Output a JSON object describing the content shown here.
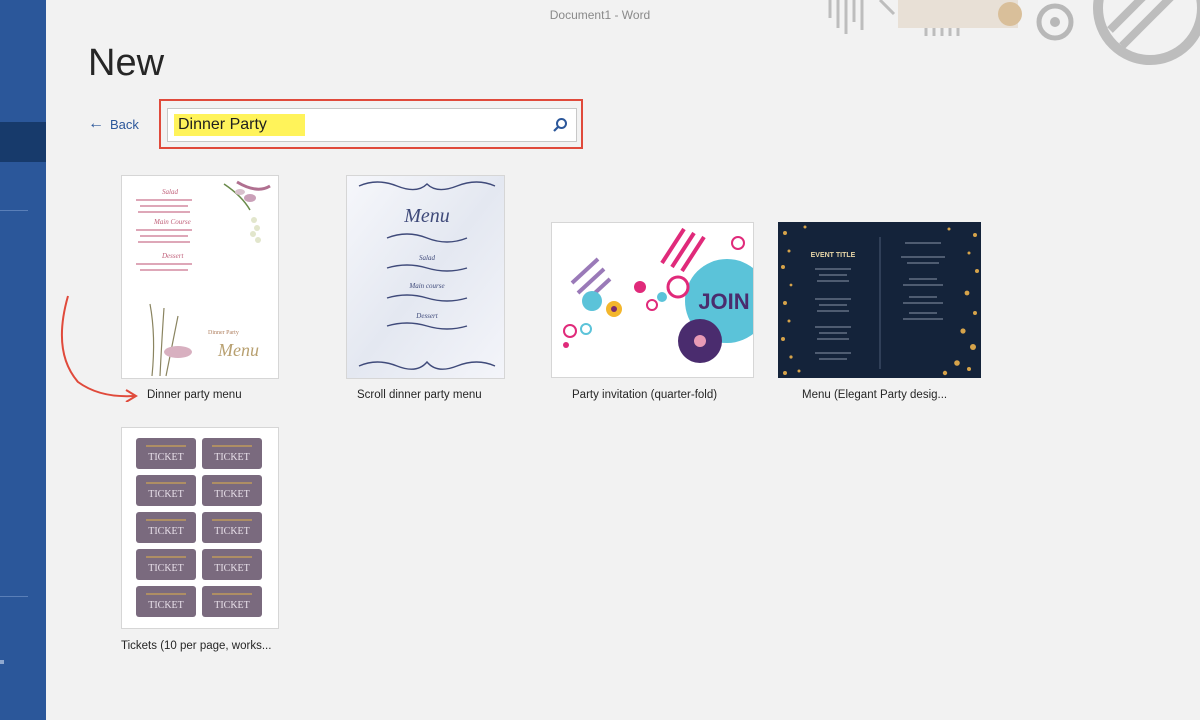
{
  "window": {
    "title": "Document1 - Word"
  },
  "page": {
    "heading": "New"
  },
  "nav": {
    "back_label": "Back"
  },
  "search": {
    "value": "Dinner Party",
    "placeholder": ""
  },
  "templates": [
    {
      "label": "Dinner party menu",
      "thumb_text": [
        "Salad",
        "Main Course",
        "Dessert",
        "Dinner Party",
        "Menu"
      ]
    },
    {
      "label": "Scroll dinner party menu",
      "thumb_text": [
        "Menu",
        "Salad",
        "Main course",
        "Dessert"
      ]
    },
    {
      "label": "Party invitation (quarter-fold)",
      "thumb_text": [
        "JOIN"
      ]
    },
    {
      "label": "Menu (Elegant Party desig...",
      "thumb_text": [
        "EVENT TITLE"
      ]
    },
    {
      "label": "Tickets (10 per page, works...",
      "thumb_text": [
        "TICKET"
      ]
    }
  ],
  "colors": {
    "sidebar": "#2b579a",
    "callout": "#e04a3b",
    "highlight": "#fff35a"
  }
}
